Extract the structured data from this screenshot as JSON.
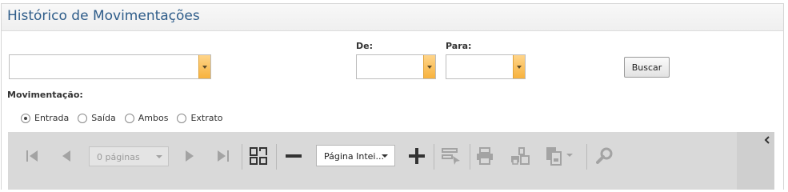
{
  "panel": {
    "title": "Histórico de Movimentações"
  },
  "filters": {
    "main_select_value": "",
    "de_label": "De:",
    "de_value": "",
    "para_label": "Para:",
    "para_value": "",
    "search_button": "Buscar"
  },
  "movimentacao": {
    "label": "Movimentação:",
    "options": [
      "Entrada",
      "Saída",
      "Ambos",
      "Extrato"
    ],
    "selected": "Entrada"
  },
  "toolbar": {
    "pages_select": "0 páginas",
    "zoom_select": "Página Intei...",
    "icons": [
      "first-page-icon",
      "prev-page-icon",
      "next-page-icon",
      "last-page-icon",
      "multipage-icon",
      "zoom-out-icon",
      "zoom-in-icon",
      "select-tool-icon",
      "print-icon",
      "print-page-icon",
      "export-icon",
      "search-icon",
      "collapse-icon"
    ],
    "colors": {
      "accent": "#f7b23d",
      "title": "#2f5d8a",
      "toolbar_bg": "#d9d9d9"
    }
  }
}
